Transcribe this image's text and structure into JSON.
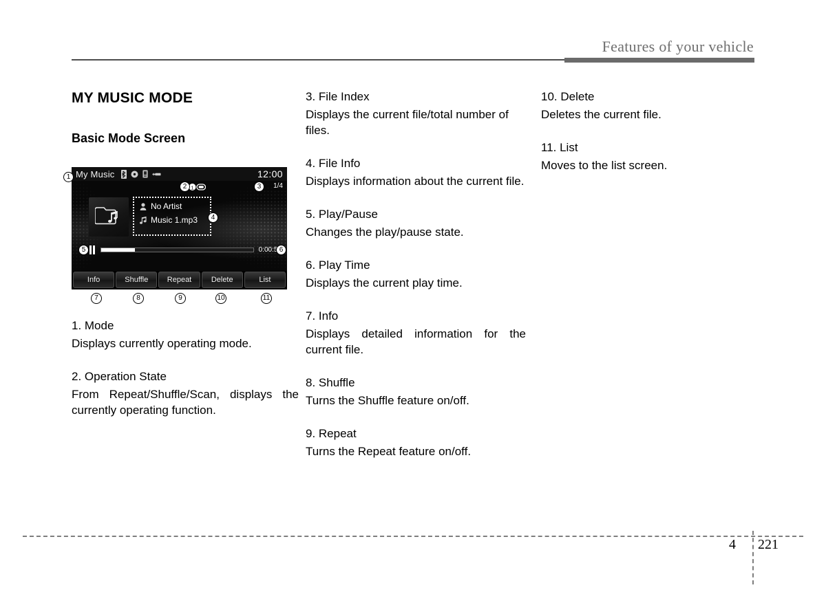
{
  "header": {
    "title": "Features of your vehicle"
  },
  "footer": {
    "chapter": "4",
    "page": "221"
  },
  "section": {
    "title": "MY MUSIC MODE",
    "subtitle": "Basic Mode Screen"
  },
  "device": {
    "mode_label": "My Music",
    "status_icons": [
      "bluetooth-icon",
      "disc-icon",
      "device-icon",
      "usb-plug-icon"
    ],
    "time": "12:00",
    "file_index": "1/4",
    "operation_state_icon": "repeat-one-icon",
    "album_art_icon": "folder-music-icon",
    "artist_icon": "person-icon",
    "artist": "No Artist",
    "track_icon": "music-note-icon",
    "track": "Music 1.mp3",
    "play_state_icon": "pause-icon",
    "progress_percent": 22,
    "play_time": "0:00:50",
    "buttons": [
      {
        "label": "Info"
      },
      {
        "label": "Shuffle"
      },
      {
        "label": "Repeat"
      },
      {
        "label": "Delete"
      },
      {
        "label": "List"
      }
    ],
    "callouts": {
      "c1": "1",
      "c2": "2",
      "c3": "3",
      "c4": "4",
      "c5": "5",
      "c6": "6",
      "c7": "7",
      "c8": "8",
      "c9": "9",
      "c10": "10",
      "c11": "11"
    }
  },
  "columns": {
    "left": [
      {
        "title": "1. Mode",
        "body": "Displays currently operating mode."
      },
      {
        "title": "2. Operation State",
        "body": "From Repeat/Shuffle/Scan, displays the currently operating function."
      }
    ],
    "middle": [
      {
        "title": "3. File Index",
        "body": "Displays the current file/total number of files."
      },
      {
        "title": "4. File Info",
        "body": "Displays information about the current file."
      },
      {
        "title": "5. Play/Pause",
        "body": "Changes the play/pause state."
      },
      {
        "title": "6. Play Time",
        "body": "Displays the current play time."
      },
      {
        "title": "7. Info",
        "body": "Displays detailed information for the current file."
      },
      {
        "title": "8. Shuffle",
        "body": "Turns the Shuffle feature on/off."
      },
      {
        "title": "9. Repeat",
        "body": "Turns the Repeat feature on/off."
      }
    ],
    "right": [
      {
        "title": "10. Delete",
        "body": "Deletes the current file."
      },
      {
        "title": "11. List",
        "body": "Moves to the list screen."
      }
    ]
  }
}
